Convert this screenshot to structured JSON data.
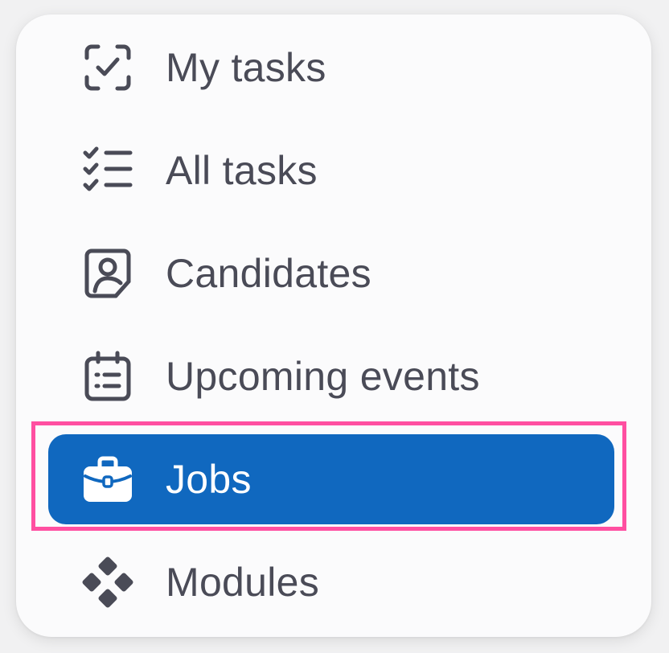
{
  "menu": {
    "items": [
      {
        "key": "my_tasks",
        "label": "My tasks",
        "icon": "task-done-icon"
      },
      {
        "key": "all_tasks",
        "label": "All tasks",
        "icon": "list-task-icon"
      },
      {
        "key": "candidates",
        "label": "Candidates",
        "icon": "user-profile-icon"
      },
      {
        "key": "upcoming_events",
        "label": "Upcoming events",
        "icon": "calendar-overview-icon"
      },
      {
        "key": "jobs",
        "label": "Jobs",
        "icon": "briefcase-icon",
        "active": true
      },
      {
        "key": "modules",
        "label": "Modules",
        "icon": "modules-icon"
      }
    ],
    "active_item": "Jobs"
  },
  "colors": {
    "active_background": "#1068bf",
    "text": "#4a4b57",
    "active_text": "#ffffff",
    "highlight": "#ff4fa1",
    "card_background": "#fbfbfc"
  }
}
